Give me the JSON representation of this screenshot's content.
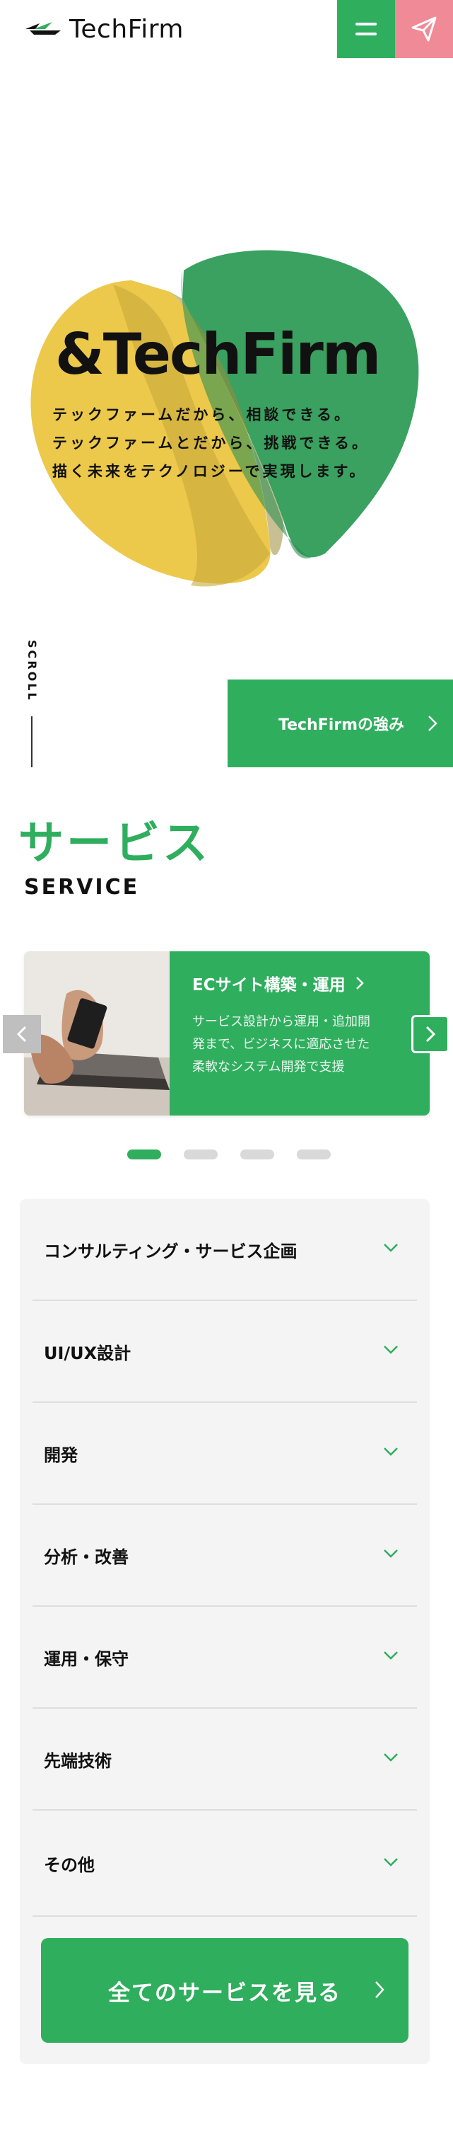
{
  "header": {
    "logo_text": "TechFirm"
  },
  "hero": {
    "title": "&TechFirm",
    "lines": [
      "テックファームだから、相談できる。",
      "テックファームとだから、挑戦できる。",
      "描く未来をテクノロジーで実現します。"
    ],
    "scroll_label": "SCROLL",
    "strength_button": "TechFirmの強み"
  },
  "service": {
    "heading_jp": "サービス",
    "heading_en": "SERVICE",
    "slide": {
      "title": "ECサイト構築・運用",
      "description": [
        "サービス設計から運用・追加開",
        "発まで、ビジネスに適応させた",
        "柔軟なシステム開発で支援"
      ]
    },
    "slide_count": 4,
    "active_slide": 1,
    "categories": [
      "コンサルティング・サービス企画",
      "UI/UX設計",
      "開発",
      "分析・改善",
      "運用・保守",
      "先端技術",
      "その他"
    ],
    "all_button": "全てのサービスを見る"
  },
  "colors": {
    "brand_green": "#2fae5e",
    "contact_pink": "#f08a96",
    "hero_yellow": "#ecc94b",
    "hero_green": "#3aa160"
  }
}
